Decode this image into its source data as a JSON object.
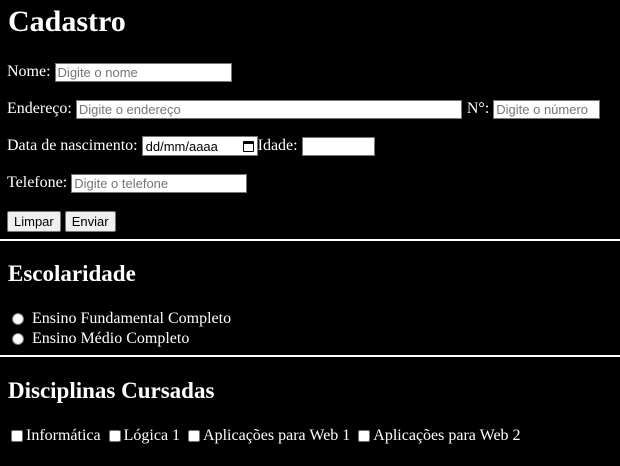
{
  "title": "Cadastro",
  "form": {
    "nome_label": "Nome:",
    "nome_placeholder": "Digite o nome",
    "endereco_label": "Endereço:",
    "endereco_placeholder": "Digite o endereço",
    "numero_label": "N°:",
    "numero_placeholder": "Digite o número",
    "nascimento_label": "Data de nascimento:",
    "nascimento_value": "dd/mm/aaaa",
    "idade_label": "Idade:",
    "telefone_label": "Telefone:",
    "telefone_placeholder": "Digite o telefone",
    "limpar_label": "Limpar",
    "enviar_label": "Enviar"
  },
  "escolaridade": {
    "heading": "Escolaridade",
    "options": [
      "Ensino Fundamental Completo",
      "Ensino Médio Completo"
    ]
  },
  "disciplinas": {
    "heading": "Disciplinas Cursadas",
    "options": [
      "Informática",
      "Lógica 1",
      "Aplicações para Web 1",
      "Aplicações para Web 2"
    ]
  },
  "icons": {
    "date_picker": "calendar-icon"
  }
}
